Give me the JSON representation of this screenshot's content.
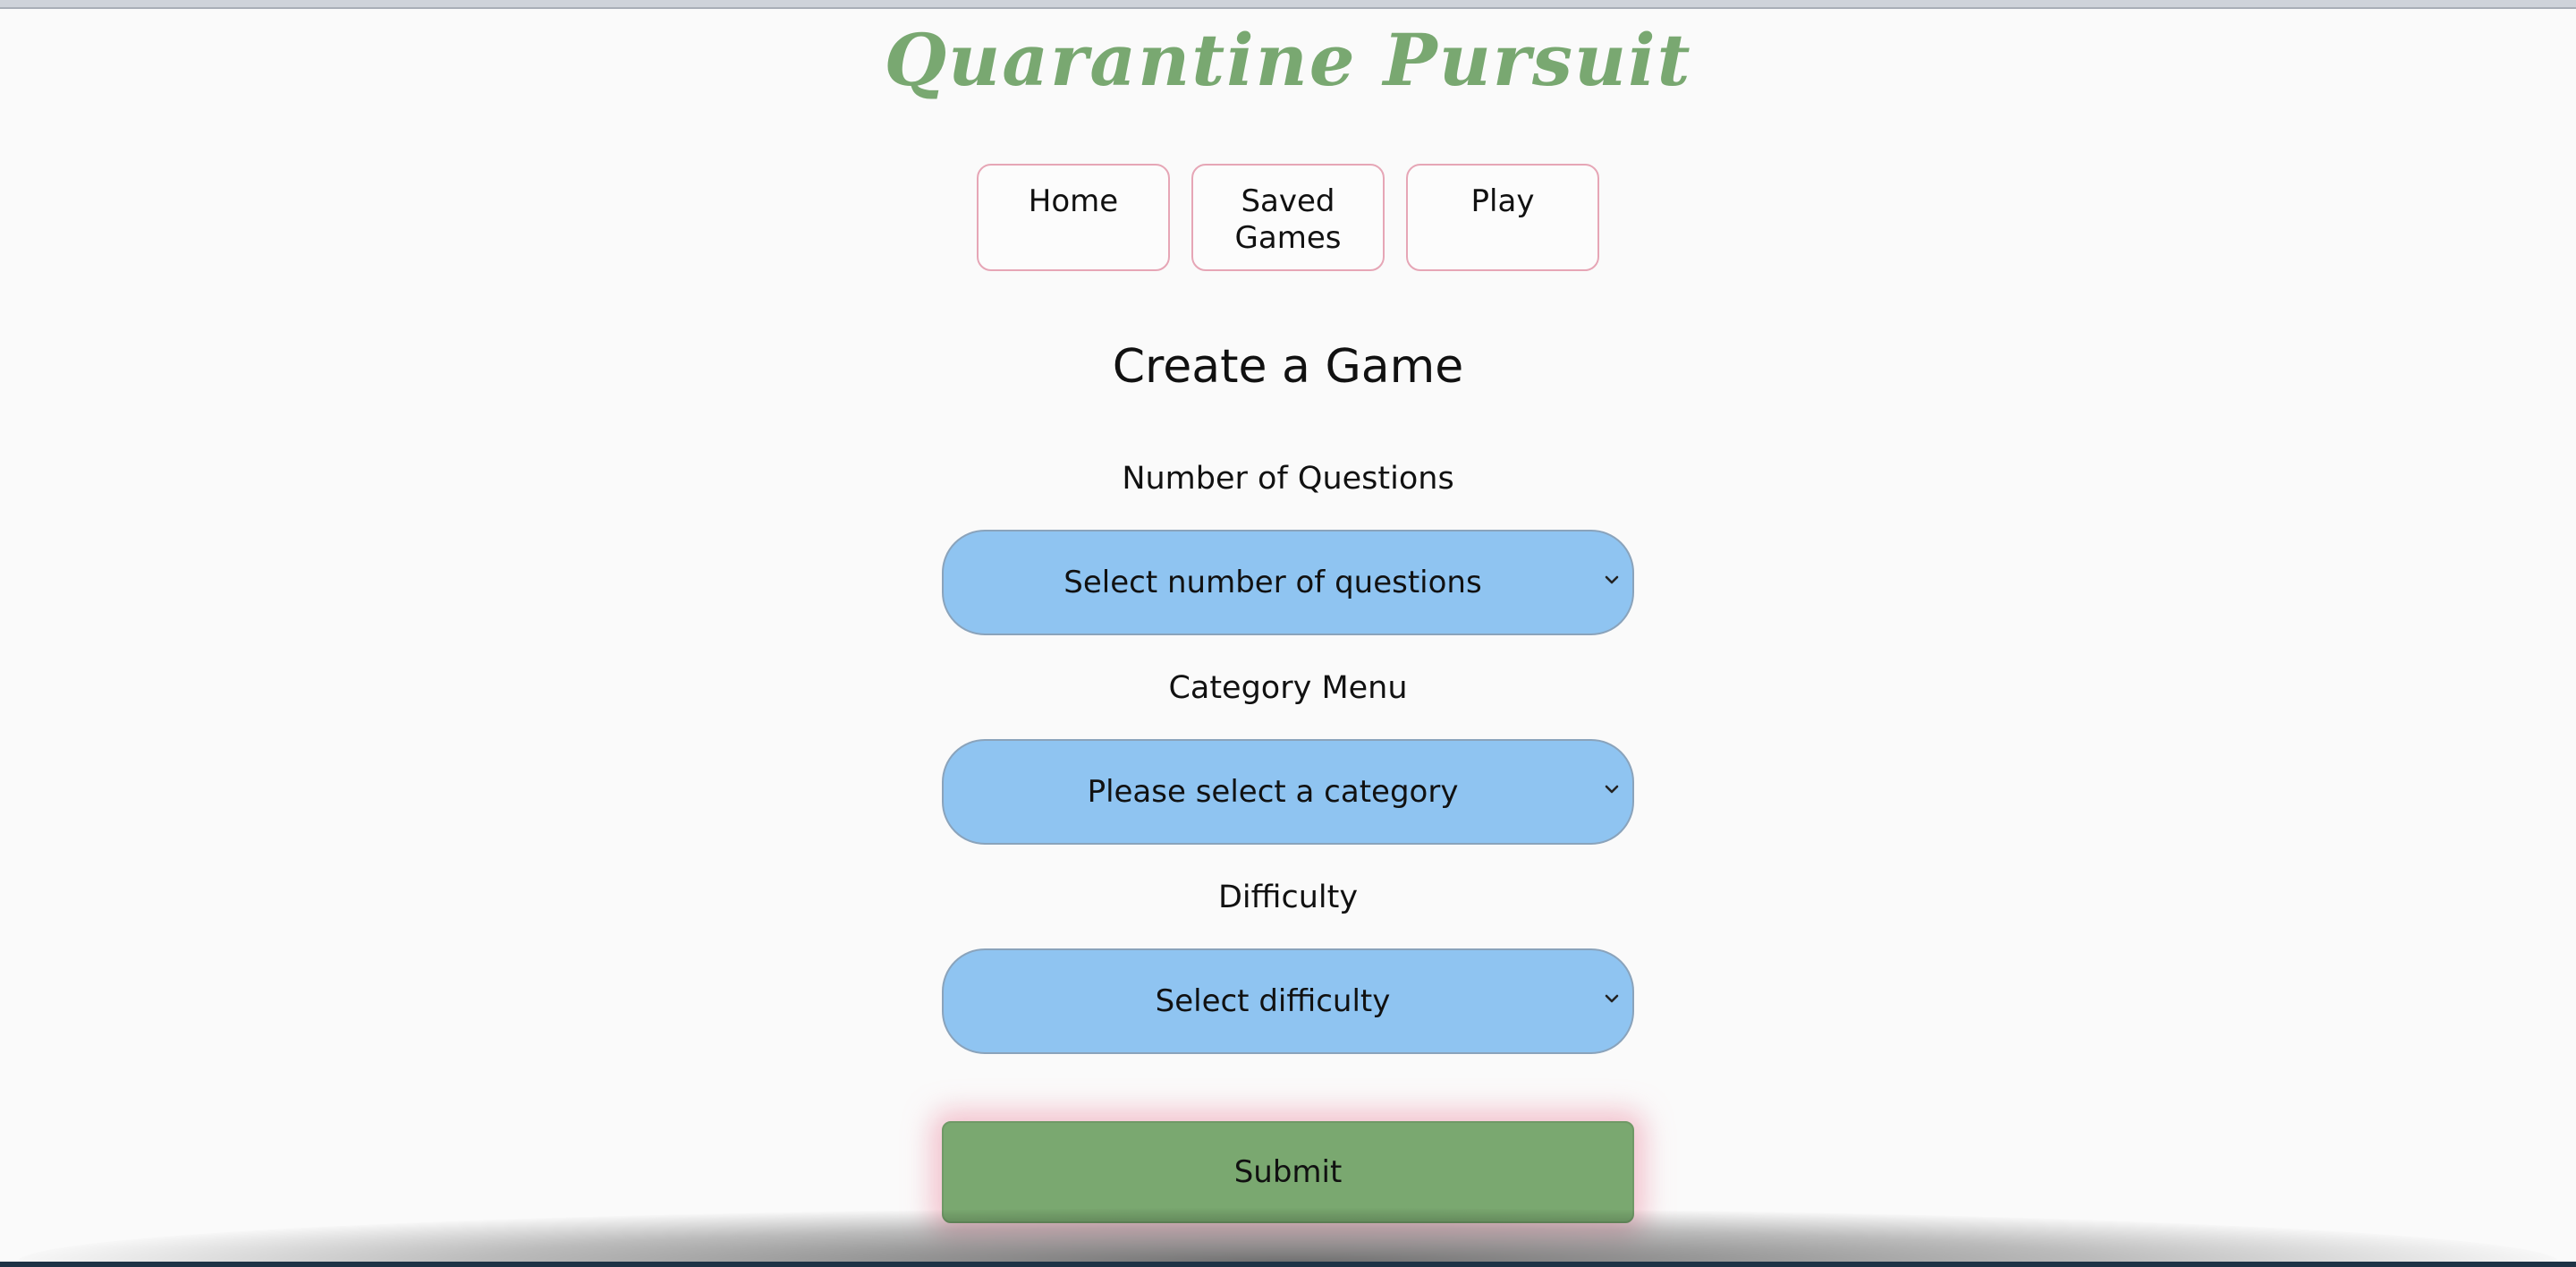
{
  "site": {
    "title": "Quarantine Pursuit"
  },
  "nav": {
    "items": [
      {
        "label": "Home"
      },
      {
        "label": "Saved Games"
      },
      {
        "label": "Play"
      }
    ]
  },
  "form": {
    "heading": "Create a Game",
    "questions": {
      "label": "Number of Questions",
      "selected": "Select number of questions"
    },
    "category": {
      "label": "Category Menu",
      "selected": "Please select a category"
    },
    "difficulty": {
      "label": "Difficulty",
      "selected": "Select difficulty"
    },
    "submit_label": "Submit"
  },
  "colors": {
    "title": "#79a871",
    "select_bg": "#8fc4f1",
    "submit_bg": "#7aa870",
    "nav_border": "#e6a6b6",
    "submit_glow": "#ec96aa"
  },
  "icons": {
    "select_arrow": "chevron-down-icon"
  }
}
